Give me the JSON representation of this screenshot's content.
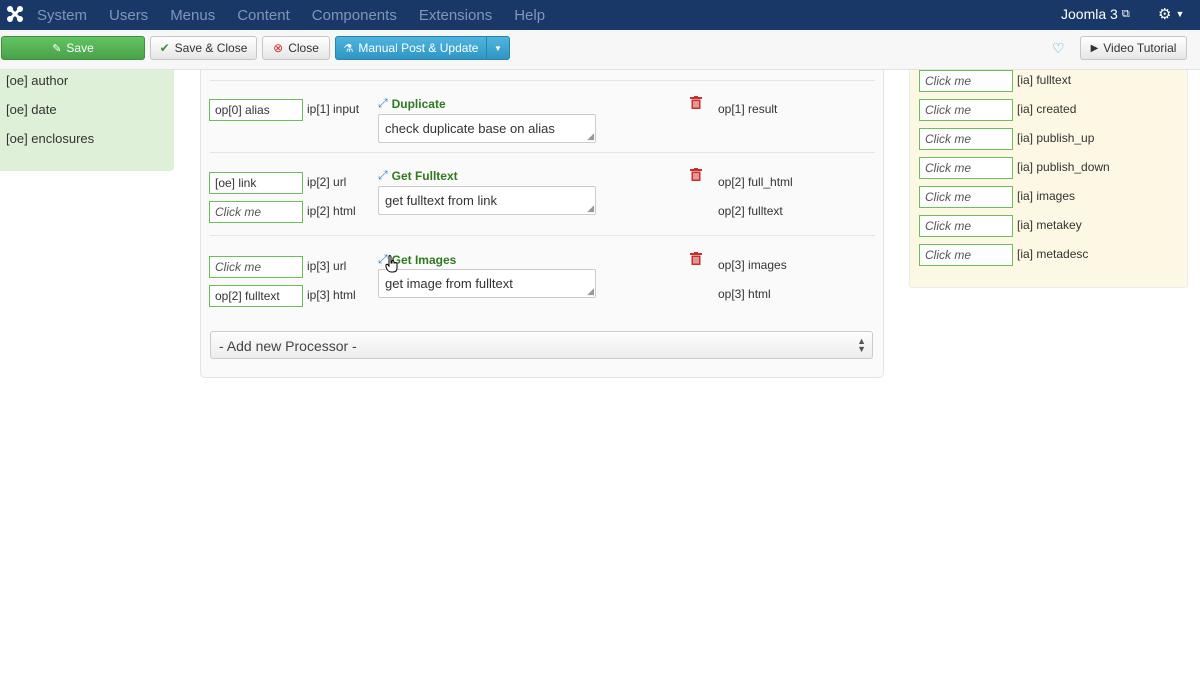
{
  "topnav": {
    "menu": [
      "System",
      "Users",
      "Menus",
      "Content",
      "Components",
      "Extensions",
      "Help"
    ],
    "site_name": "Joomla 3"
  },
  "toolbar": {
    "save": "Save",
    "save_close": "Save & Close",
    "close": "Close",
    "manual_post": "Manual Post & Update",
    "video_tutorial": "Video Tutorial"
  },
  "left_panel": {
    "items": [
      "[oe] author",
      "[oe] date",
      "[oe] enclosures"
    ]
  },
  "processors": [
    {
      "title": "Duplicate",
      "description": "check duplicate base on alias",
      "inputs": [
        {
          "value": "op[0] alias",
          "label": "ip[1] input",
          "placeholder": false
        }
      ],
      "outputs": [
        "op[1] result"
      ]
    },
    {
      "title": "Get Fulltext",
      "description": "get fulltext from link",
      "inputs": [
        {
          "value": "[oe] link",
          "label": "ip[2] url",
          "placeholder": false
        },
        {
          "value": "Click me",
          "label": "ip[2] html",
          "placeholder": true
        }
      ],
      "outputs": [
        "op[2] full_html",
        "op[2] fulltext"
      ]
    },
    {
      "title": "Get Images",
      "description": "get image from fulltext",
      "inputs": [
        {
          "value": "Click me",
          "label": "ip[3] url",
          "placeholder": true
        },
        {
          "value": "op[2] fulltext",
          "label": "ip[3] html",
          "placeholder": false
        }
      ],
      "outputs": [
        "op[3] images",
        "op[3] html"
      ]
    }
  ],
  "add_processor": "- Add new Processor -",
  "right_panel": {
    "rows": [
      {
        "field": "Click me",
        "label": "[ia] fulltext"
      },
      {
        "field": "Click me",
        "label": "[ia] created"
      },
      {
        "field": "Click me",
        "label": "[ia] publish_up"
      },
      {
        "field": "Click me",
        "label": "[ia] publish_down"
      },
      {
        "field": "Click me",
        "label": "[ia] images"
      },
      {
        "field": "Click me",
        "label": "[ia] metakey"
      },
      {
        "field": "Click me",
        "label": "[ia] metadesc"
      }
    ]
  },
  "colors": {
    "navbar": "#1a3867",
    "save_green": "#5bb75b",
    "accent_blue": "#2f96c4",
    "field_border": "#6abf5b",
    "processor_title": "#2f7a1f",
    "trash_red": "#c9302c"
  }
}
